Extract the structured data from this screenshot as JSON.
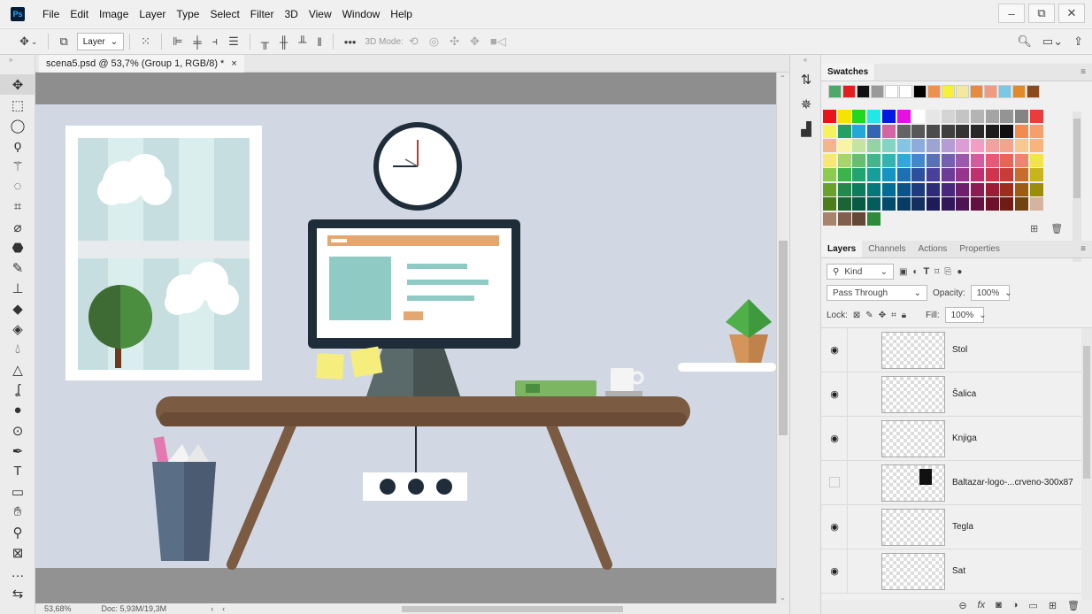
{
  "menubar": {
    "logo": "Ps",
    "items": [
      "File",
      "Edit",
      "Image",
      "Layer",
      "Type",
      "Select",
      "Filter",
      "3D",
      "View",
      "Window",
      "Help"
    ],
    "window_buttons": [
      "–",
      "⧉",
      "✕"
    ]
  },
  "options": {
    "layer_select": "Layer",
    "mode_label": "3D Mode:"
  },
  "document": {
    "tab_title": "scena5.psd @ 53,7% (Group 1, RGB/8) *",
    "tab_close": "×"
  },
  "status": {
    "zoom": "53,68%",
    "doc": "Doc: 5,93M/19,3M"
  },
  "swatches": {
    "tab": "Swatches",
    "recent": [
      "#4fa86a",
      "#e02020",
      "#111111",
      "#999999",
      "#ffffff",
      "#ffffff",
      "#000000",
      "#f09050",
      "#f6f03c",
      "#f4e8a0",
      "#e68a40",
      "#f09a80",
      "#79c8e6",
      "#e28a28",
      "#8b4a1c"
    ],
    "grid": [
      [
        "#e8141c",
        "#f6e400",
        "#20d820",
        "#20e8e8",
        "#0018e0",
        "#e810e0",
        "#ffffff",
        "#e6e6e6",
        "#d4d4d4",
        "#c4c4c4",
        "#b4b4b4",
        "#a4a4a4",
        "#949494",
        "#848484",
        "#ea3c3c"
      ],
      [
        "#f4f458",
        "#24a064",
        "#24a8d8",
        "#3464b4",
        "#d464a4",
        "#646464",
        "#585858",
        "#4c4c4c",
        "#404040",
        "#343434",
        "#282828",
        "#1c1c1c",
        "#101010",
        "#f08c50",
        "#f4a06c"
      ],
      [
        "#f4b48c",
        "#f8f4a4",
        "#c4e4a4",
        "#94d4a4",
        "#84d4c4",
        "#84c4e4",
        "#8cacdc",
        "#9ca4d4",
        "#b49cd4",
        "#dc9cd4",
        "#f49cc4",
        "#f4a0a0",
        "#f4a48c",
        "#f8c890",
        "#f8b47c"
      ],
      [
        "#f8e870",
        "#a8d470",
        "#64c06c",
        "#44b48c",
        "#34b4b0",
        "#30a8dc",
        "#4488cc",
        "#5870b8",
        "#7460b0",
        "#9c58ac",
        "#d45c9c",
        "#e85878",
        "#e86454",
        "#f0846c",
        "#f4e44c"
      ],
      [
        "#8ccc4c",
        "#3cb44c",
        "#20a470",
        "#14a098",
        "#1494c4",
        "#1c70b4",
        "#2c50a0",
        "#48409c",
        "#6c3c98",
        "#98348c",
        "#c03070",
        "#d0344c",
        "#c83c38",
        "#c86c2c",
        "#c8b41c"
      ],
      [
        "#6ca02c",
        "#24884c",
        "#0c7c5c",
        "#047878",
        "#046c94",
        "#0c5488",
        "#1c3c7c",
        "#2c2c78",
        "#482878",
        "#6c206c",
        "#8c1c54",
        "#9c1c34",
        "#9c2c1c",
        "#9c5c14",
        "#9c8c0c"
      ],
      [
        "#4c7c1c",
        "#1c6434",
        "#085c44",
        "#045c5c",
        "#044c6c",
        "#083c64",
        "#14305c",
        "#1c1c58",
        "#301858",
        "#4c1450",
        "#641040",
        "#701028",
        "#701c14",
        "#704410",
        "#d4b4a0"
      ],
      [
        "#a8846c",
        "#80604c",
        "#644838",
        "#2c8c3c"
      ]
    ]
  },
  "panels": {
    "tabs": [
      "Layers",
      "Channels",
      "Actions",
      "Properties"
    ],
    "kind": "Kind",
    "blend_mode": "Pass Through",
    "opacity_label": "Opacity:",
    "opacity_value": "100%",
    "lock_label": "Lock:",
    "fill_label": "Fill:",
    "fill_value": "100%"
  },
  "layers": [
    {
      "name": "Stol",
      "visible": true
    },
    {
      "name": "Šalica",
      "visible": true
    },
    {
      "name": "Knjiga",
      "visible": true
    },
    {
      "name": "Baltazar-logo-...crveno-300x87",
      "visible": false
    },
    {
      "name": "Tegla",
      "visible": true
    },
    {
      "name": "Sat",
      "visible": true
    }
  ],
  "colors": {
    "wall": "#d2d8e3",
    "floor": "#929292",
    "desk": "#7b5b42",
    "monitor": "#1f2d3a",
    "accent_teal": "#8fcbc4",
    "leaf": "#4b8e3f"
  }
}
